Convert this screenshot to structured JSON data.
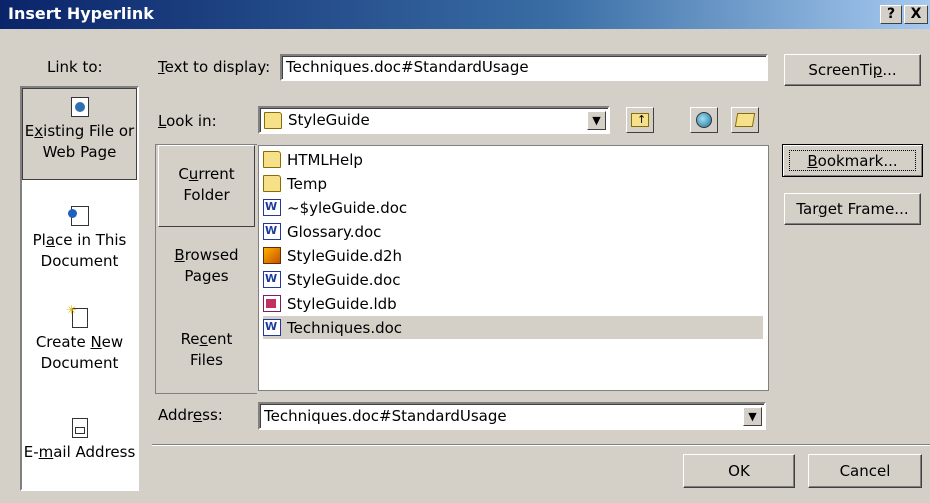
{
  "window": {
    "title": "Insert Hyperlink",
    "help_glyph": "?",
    "close_glyph": "X"
  },
  "link_to": {
    "label": "Link to:",
    "items": [
      {
        "line1_pre": "E",
        "line1_u": "x",
        "line1_post": "isting File or",
        "line2": "Web Page",
        "icon": "existing-file-icon",
        "selected": true
      },
      {
        "line1_pre": "Pl",
        "line1_u": "a",
        "line1_post": "ce in This",
        "line2": "Document",
        "icon": "place-in-document-icon",
        "selected": false
      },
      {
        "line1_pre": "Create ",
        "line1_u": "N",
        "line1_post": "ew",
        "line2": "Document",
        "icon": "create-new-document-icon",
        "selected": false
      },
      {
        "line1_pre": "E-",
        "line1_u": "m",
        "line1_post": "ail Address",
        "line2": "",
        "icon": "email-address-icon",
        "selected": false
      }
    ]
  },
  "text_to_display": {
    "label_u": "T",
    "label_rest": "ext to display:",
    "value": "Techniques.doc#StandardUsage"
  },
  "look_in": {
    "label_u": "L",
    "label_rest": "ook in:",
    "value": "StyleGuide"
  },
  "folder_buttons": [
    {
      "line1_pre": "C",
      "line1_u": "u",
      "line1_post": "rrent",
      "line2": "Folder",
      "selected": true
    },
    {
      "line1_pre": "",
      "line1_u": "B",
      "line1_post": "rowsed",
      "line2": "Pages",
      "selected": false
    },
    {
      "line1_pre": "Re",
      "line1_u": "c",
      "line1_post": "ent",
      "line2": "Files",
      "selected": false
    }
  ],
  "files": [
    {
      "name": "HTMLHelp",
      "type": "folder"
    },
    {
      "name": "Temp",
      "type": "folder"
    },
    {
      "name": "~$yleGuide.doc",
      "type": "word"
    },
    {
      "name": "Glossary.doc",
      "type": "word"
    },
    {
      "name": "StyleGuide.d2h",
      "type": "d2h"
    },
    {
      "name": "StyleGuide.doc",
      "type": "word"
    },
    {
      "name": "StyleGuide.ldb",
      "type": "ldb"
    },
    {
      "name": "Techniques.doc",
      "type": "word",
      "selected": true
    }
  ],
  "address": {
    "label_pre": "Addr",
    "label_u": "e",
    "label_post": "ss:",
    "value": "Techniques.doc#StandardUsage"
  },
  "buttons": {
    "screentip": {
      "pre": "ScreenTi",
      "u": "p",
      "post": "..."
    },
    "bookmark": {
      "pre": "",
      "u": "B",
      "post": "ookmark..."
    },
    "target_frame": {
      "pre": "Tar",
      "u": "g",
      "post": "et Frame..."
    },
    "ok": "OK",
    "cancel": "Cancel"
  }
}
